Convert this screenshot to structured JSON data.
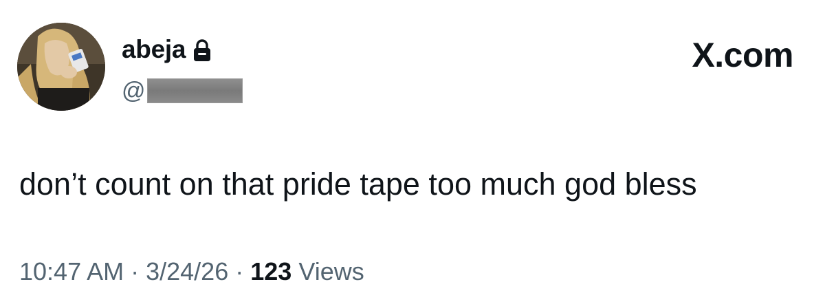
{
  "user": {
    "display_name": "abeja",
    "handle_prefix": "@"
  },
  "brand": {
    "label": "X.com"
  },
  "tweet": {
    "text": "don’t count on that pride tape too much god bless"
  },
  "meta": {
    "time": "10:47 AM",
    "separator": "·",
    "date": "3/24/26",
    "views_count": "123",
    "views_label": "Views"
  },
  "icons": {
    "protected": "lock-icon",
    "avatar": "profile-photo"
  },
  "colors": {
    "text_primary": "#0f1419",
    "text_secondary": "#536471",
    "background": "#ffffff",
    "redaction": "#808080"
  }
}
